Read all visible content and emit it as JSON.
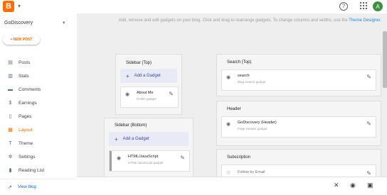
{
  "topbar": {
    "logo_letter": "B",
    "avatar_letter": "A",
    "help_label": "?"
  },
  "sidebar": {
    "blog_name": "GoDiscovery",
    "new_post_label": "+ NEW POST",
    "items": [
      {
        "label": "Posts",
        "icon": "posts-icon"
      },
      {
        "label": "Stats",
        "icon": "stats-icon"
      },
      {
        "label": "Comments",
        "icon": "comments-icon"
      },
      {
        "label": "Earnings",
        "icon": "earnings-icon"
      },
      {
        "label": "Pages",
        "icon": "pages-icon"
      },
      {
        "label": "Layout",
        "icon": "layout-icon",
        "active": true
      },
      {
        "label": "Theme",
        "icon": "theme-icon"
      },
      {
        "label": "Settings",
        "icon": "settings-icon"
      },
      {
        "label": "Reading List",
        "icon": "reading-list-icon"
      }
    ],
    "view_blog_label": "View blog"
  },
  "main": {
    "hint_text": "Add, remove and edit gadgets on your blog. Click and drag to rearrange gadgets. To change columns and widths, use the",
    "hint_link": "Theme Designer.",
    "sidebar_top": {
      "title": "Sidebar (Top)",
      "add_label": "Add a Gadget",
      "gadgets": [
        {
          "name": "About Me",
          "sub": "Profile gadget"
        }
      ]
    },
    "sidebar_bottom": {
      "title": "Sidebar (Bottom)",
      "add_label": "Add a Gadget",
      "gadgets": [
        {
          "name": "HTML/JavaScript",
          "sub": "HTML/JavaScript gadget"
        }
      ]
    },
    "search_top": {
      "title": "Search (Top)",
      "gadgets": [
        {
          "name": "search",
          "sub": "Blog Search gadget"
        }
      ]
    },
    "header": {
      "title": "Header",
      "gadgets": [
        {
          "name": "GoDiscovery (Header)",
          "sub": "Page Header gadget"
        }
      ]
    },
    "subscription": {
      "title": "Subscription",
      "gadgets": [
        {
          "name": "Follow by Email",
          "sub": ""
        }
      ]
    }
  },
  "colors": {
    "accent": "#ef6c00",
    "link": "#1e88e5",
    "canvas": "#eeeeee"
  }
}
